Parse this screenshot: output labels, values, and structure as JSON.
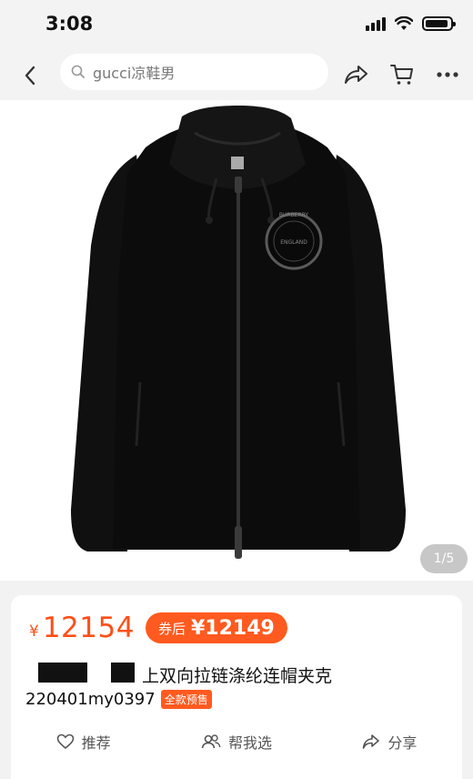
{
  "status": {
    "time": "3:08"
  },
  "nav": {
    "search_text": "gucci凉鞋男"
  },
  "product": {
    "image_alt": "black zip-up hooded jacket",
    "logo_text_top": "BURBERRY",
    "logo_text_bottom": "ENGLAND",
    "page_indicator": "1/5",
    "currency": "¥",
    "price": "12154",
    "coupon_label": "券后",
    "coupon_price": "¥12149",
    "title": "上双向拉链涤纶连帽夹克",
    "code": "220401my0397",
    "presale_badge": "全款预售"
  },
  "actions": [
    {
      "label": "推荐",
      "icon": "heart-icon"
    },
    {
      "label": "帮我选",
      "icon": "people-icon"
    },
    {
      "label": "分享",
      "icon": "share-icon"
    }
  ],
  "colors": {
    "accent": "#ff5a1f",
    "price": "#ff4f17"
  }
}
